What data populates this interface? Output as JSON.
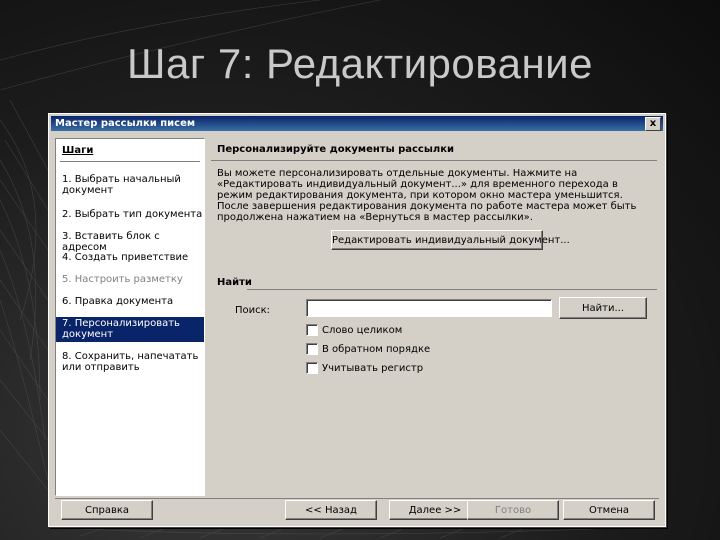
{
  "slide": {
    "title": "Шаг 7: Редактирование"
  },
  "window": {
    "title": "Мастер рассылки писем",
    "close_label": "x"
  },
  "steps": {
    "header": "Шаги",
    "items": [
      {
        "label": "1. Выбрать начальный документ",
        "state": "normal"
      },
      {
        "label": "2. Выбрать тип документа",
        "state": "normal"
      },
      {
        "label": "3. Вставить блок с адресом",
        "state": "normal"
      },
      {
        "label": "4. Создать приветствие",
        "state": "normal"
      },
      {
        "label": "5. Настроить разметку",
        "state": "disabled"
      },
      {
        "label": "6. Правка документа",
        "state": "normal"
      },
      {
        "label": "7. Персонализировать документ",
        "state": "active"
      },
      {
        "label": "8. Сохранить, напечатать или отправить",
        "state": "normal"
      }
    ]
  },
  "main": {
    "section_title": "Персонализируйте документы рассылки",
    "description": "Вы можете персонализировать отдельные документы. Нажмите на «Редактировать индивидуальный документ...» для временного перехода в режим редактирования документа, при котором окно мастера уменьшится. После завершения редактирования документа по работе мастера может быть продолжена нажатием на «Вернуться в мастер рассылки».",
    "edit_button": "Редактировать индивидуальный документ...",
    "find": {
      "label": "Найти",
      "search_label": "Поиск:",
      "search_value": "",
      "find_button": "Найти...",
      "options": [
        {
          "label": "Слово целиком"
        },
        {
          "label": "В обратном порядке"
        },
        {
          "label": "Учитывать регистр"
        }
      ]
    }
  },
  "footer": {
    "help": "Справка",
    "back": "<< Назад",
    "next": "Далее >>",
    "finish": "Готово",
    "cancel": "Отмена"
  }
}
